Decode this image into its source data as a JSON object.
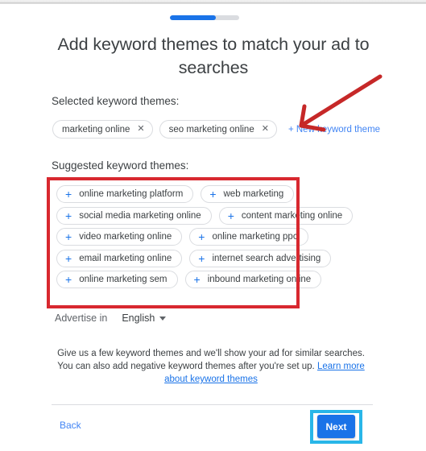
{
  "progress": {
    "percent": 66,
    "accent_color": "#1a73e8",
    "track_color": "#dadce0"
  },
  "header": {
    "title": "Add keyword themes to match your ad to searches"
  },
  "selected_section": {
    "label": "Selected keyword themes:",
    "chips": [
      {
        "label": "marketing online",
        "remove_icon": "✕"
      },
      {
        "label": "seo marketing online",
        "remove_icon": "✕"
      }
    ],
    "new_theme_link": "+ New keyword theme"
  },
  "suggested_section": {
    "label": "Suggested keyword themes:",
    "add_icon": "+",
    "rows": [
      [
        "online marketing platform",
        "web marketing"
      ],
      [
        "social media marketing online",
        "content marketing online"
      ],
      [
        "video marketing online",
        "online marketing ppc"
      ],
      [
        "email marketing online",
        "internet search advertising"
      ],
      [
        "online marketing sem",
        "inbound marketing online"
      ]
    ]
  },
  "advertise": {
    "label": "Advertise in",
    "language_value": "English",
    "language_options": [
      "English"
    ]
  },
  "helper": {
    "text_before": "Give us a few keyword themes and we'll show your ad for similar searches. You can also add negative keyword themes after you're set up. ",
    "link_text": "Learn more about keyword themes"
  },
  "footer": {
    "back_label": "Back",
    "next_label": "Next"
  },
  "annotations": {
    "suggest_box_color": "#d8282f",
    "arrow_color": "#c62828",
    "next_highlight_color": "#29b6e8"
  }
}
